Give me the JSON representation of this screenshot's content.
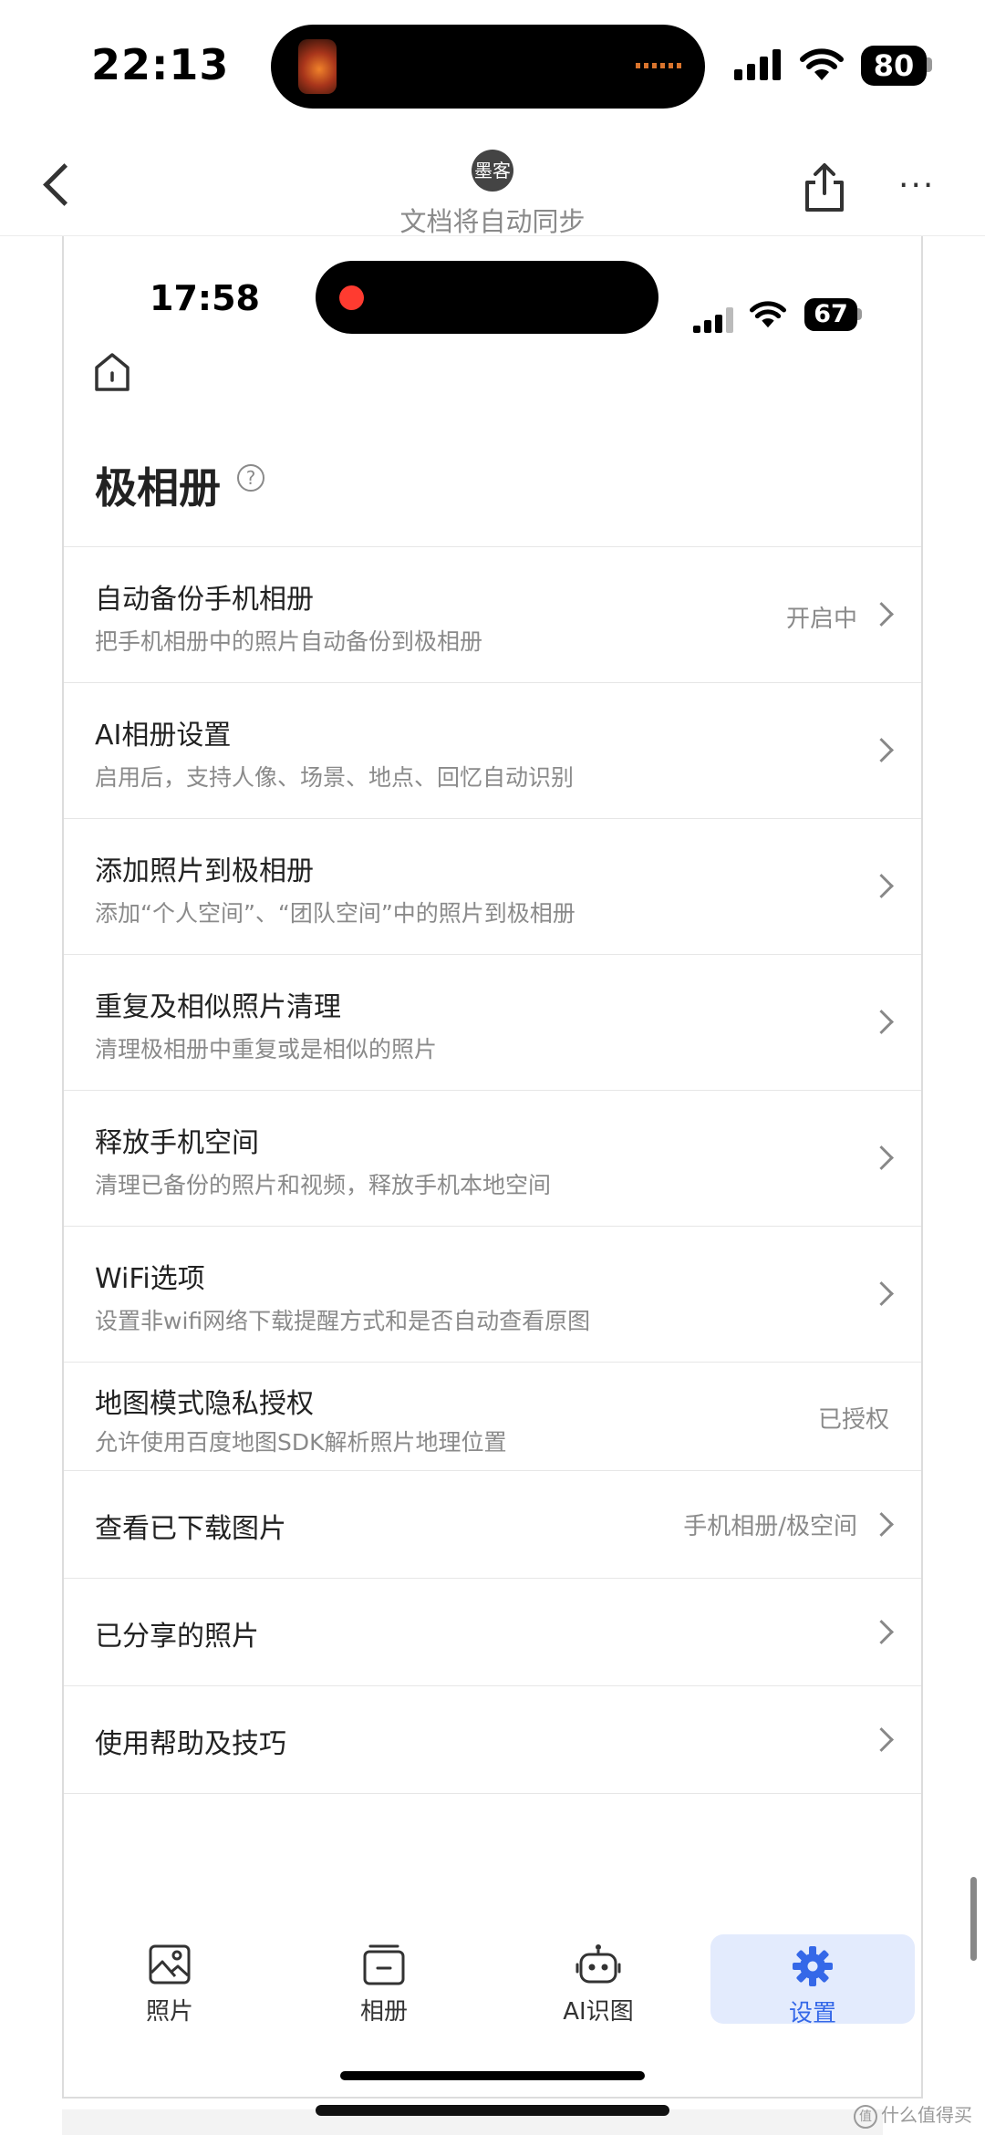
{
  "outer": {
    "status": {
      "time": "22:13",
      "battery": "80"
    },
    "nav": {
      "avatar_text": "墨客",
      "sync_text": "文档将自动同步"
    },
    "more_label": "···"
  },
  "inner": {
    "status": {
      "time": "17:58",
      "battery": "67"
    },
    "title": "极相册",
    "help_glyph": "?",
    "settings": [
      {
        "title": "自动备份手机相册",
        "subtitle": "把手机相册中的照片自动备份到极相册",
        "status": "开启中"
      },
      {
        "title": "AI相册设置",
        "subtitle": "启用后，支持人像、场景、地点、回忆自动识别",
        "status": ""
      },
      {
        "title": "添加照片到极相册",
        "subtitle": "添加“个人空间”、“团队空间”中的照片到极相册",
        "status": ""
      },
      {
        "title": "重复及相似照片清理",
        "subtitle": "清理极相册中重复或是相似的照片",
        "status": ""
      },
      {
        "title": "释放手机空间",
        "subtitle": "清理已备份的照片和视频，释放手机本地空间",
        "status": ""
      },
      {
        "title": "WiFi选项",
        "subtitle": "设置非wifi网络下载提醒方式和是否自动查看原图",
        "status": ""
      },
      {
        "title": "地图模式隐私授权",
        "subtitle": "允许使用百度地图SDK解析照片地理位置",
        "status": "已授权"
      },
      {
        "title": "查看已下载图片",
        "subtitle": "",
        "status": "手机相册/极空间"
      },
      {
        "title": "已分享的照片",
        "subtitle": "",
        "status": ""
      },
      {
        "title": "使用帮助及技巧",
        "subtitle": "",
        "status": ""
      }
    ],
    "tabs": [
      {
        "label": "照片",
        "icon": "photo-icon"
      },
      {
        "label": "相册",
        "icon": "album-icon"
      },
      {
        "label": "AI识图",
        "icon": "robot-icon"
      },
      {
        "label": "设置",
        "icon": "gear-icon",
        "active": true
      }
    ],
    "accent_color": "#3568e8"
  },
  "watermark": {
    "text": "什么值得买",
    "glyph": "值"
  }
}
